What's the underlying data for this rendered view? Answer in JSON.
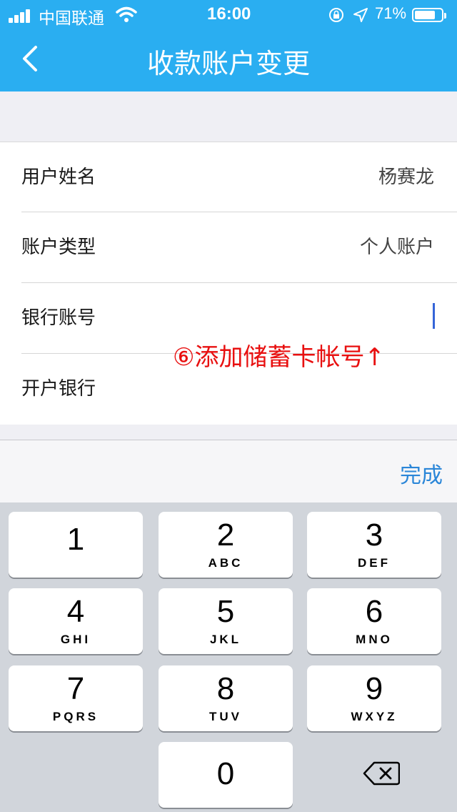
{
  "status_bar": {
    "carrier": "中国联通",
    "time": "16:00",
    "battery_percent": "71%",
    "battery_level": 0.71
  },
  "header": {
    "title": "收款账户变更",
    "accent_color": "#2aaef1"
  },
  "form": {
    "rows": [
      {
        "label": "用户姓名",
        "value": "杨赛龙"
      },
      {
        "label": "账户类型",
        "value": "个人账户"
      },
      {
        "label": "银行账号",
        "value": ""
      },
      {
        "label": "开户银行",
        "value": ""
      }
    ],
    "annotation": "⑥添加储蓄卡帐号↑"
  },
  "accessory": {
    "done_label": "完成"
  },
  "keypad": {
    "keys": [
      {
        "num": "1",
        "letters": ""
      },
      {
        "num": "2",
        "letters": "ABC"
      },
      {
        "num": "3",
        "letters": "DEF"
      },
      {
        "num": "4",
        "letters": "GHI"
      },
      {
        "num": "5",
        "letters": "JKL"
      },
      {
        "num": "6",
        "letters": "MNO"
      },
      {
        "num": "7",
        "letters": "PQRS"
      },
      {
        "num": "8",
        "letters": "TUV"
      },
      {
        "num": "9",
        "letters": "WXYZ"
      },
      {
        "num": "0",
        "letters": ""
      }
    ],
    "delete_icon": "backspace-icon"
  }
}
